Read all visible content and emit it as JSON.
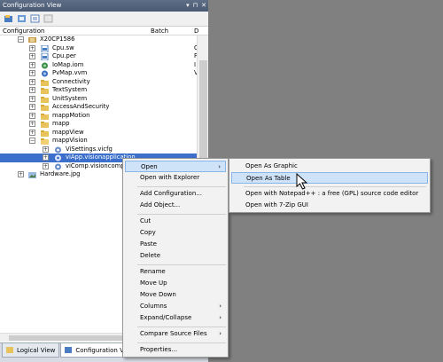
{
  "panel": {
    "title": "Configuration View",
    "title_controls": [
      "▾",
      "⊓",
      "✕"
    ],
    "columns": {
      "configuration": "Configuration",
      "batch": "Batch",
      "d": "D"
    }
  },
  "tree": [
    {
      "label": "X20CP1586",
      "type": "",
      "icon": "cpu-icon",
      "exp": "−"
    },
    {
      "label": "Cpu.sw",
      "type": "C",
      "icon": "file-icon",
      "exp": "+"
    },
    {
      "label": "Cpu.per",
      "type": "P",
      "icon": "file-icon",
      "exp": "+"
    },
    {
      "label": "IoMap.iom",
      "type": "I",
      "icon": "globe-icon",
      "exp": "+"
    },
    {
      "label": "PvMap.vvm",
      "type": "V",
      "icon": "globe-icon",
      "exp": "+"
    },
    {
      "label": "Connectivity",
      "type": "",
      "icon": "folder-icon",
      "exp": "+"
    },
    {
      "label": "TextSystem",
      "type": "",
      "icon": "folder-icon",
      "exp": "+"
    },
    {
      "label": "UnitSystem",
      "type": "",
      "icon": "folder-icon",
      "exp": "+"
    },
    {
      "label": "AccessAndSecurity",
      "type": "",
      "icon": "folder-icon",
      "exp": "+"
    },
    {
      "label": "mappMotion",
      "type": "",
      "icon": "folder-icon",
      "exp": "+"
    },
    {
      "label": "mapp",
      "type": "",
      "icon": "folder-icon",
      "exp": "+"
    },
    {
      "label": "mappView",
      "type": "",
      "icon": "folder-icon",
      "exp": "+"
    },
    {
      "label": "mappVision",
      "type": "",
      "icon": "folder-icon",
      "exp": "−"
    },
    {
      "label": "ViSettings.vicfg",
      "type": "",
      "icon": "gear-icon",
      "exp": "+"
    },
    {
      "label": "viApp.visionapplication",
      "type": "",
      "icon": "gear-icon",
      "exp": "+",
      "selected": true
    },
    {
      "label": "viComp.visioncomponent",
      "type": "",
      "icon": "gear-icon",
      "exp": "+"
    },
    {
      "label": "Hardware.jpg",
      "type": "",
      "icon": "image-icon",
      "exp": "+"
    }
  ],
  "tabs": {
    "logical": "Logical View",
    "configuration": "Configuration View"
  },
  "context_menu": {
    "open": "Open",
    "open_with_explorer": "Open with Explorer",
    "add_configuration": "Add Configuration...",
    "add_object": "Add Object...",
    "cut": "Cut",
    "copy": "Copy",
    "paste": "Paste",
    "delete": "Delete",
    "rename": "Rename",
    "move_up": "Move Up",
    "move_down": "Move Down",
    "columns": "Columns",
    "expand_collapse": "Expand/Collapse",
    "compare_source_files": "Compare Source Files",
    "properties": "Properties..."
  },
  "open_submenu": {
    "open_as_graphic": "Open As Graphic",
    "open_as_table": "Open As Table",
    "open_with_notepad": "Open with Notepad++ : a free (GPL) source code editor",
    "open_with_7zip": "Open with 7-Zip GUI"
  },
  "colors": {
    "selection": "#3b6fcb",
    "menu_highlight": "#cfe3f8",
    "background": "#808080"
  }
}
